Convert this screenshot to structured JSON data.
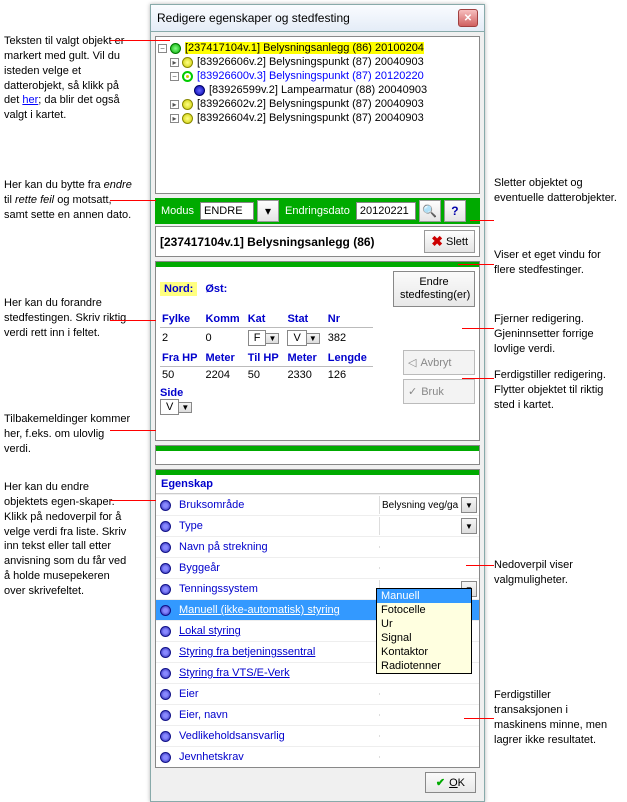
{
  "window_title": "Redigere egenskaper og stedfesting",
  "tree": [
    {
      "indent": 0,
      "toggle": "-",
      "icon": "green",
      "text": "[237417104v.1] Belysningsanlegg (86) 20100204",
      "hl": true
    },
    {
      "indent": 1,
      "toggle": ">",
      "icon": "yellow",
      "text": "[83926606v.2] Belysningspunkt (87) 20040903"
    },
    {
      "indent": 1,
      "toggle": "-",
      "icon": "ring",
      "text": "[83926600v.3] Belysningspunkt (87) 20120220",
      "sel": true
    },
    {
      "indent": 2,
      "toggle": "",
      "icon": "blue",
      "text": "[83926599v.2] Lampearmatur (88) 20040903"
    },
    {
      "indent": 1,
      "toggle": ">",
      "icon": "yellow",
      "text": "[83926602v.2] Belysningspunkt (87) 20040903"
    },
    {
      "indent": 1,
      "toggle": ">",
      "icon": "yellow",
      "text": "[83926604v.2] Belysningspunkt (87) 20040903"
    }
  ],
  "modus_label": "Modus",
  "modus_value": "ENDRE",
  "endringsdato_label": "Endringsdato",
  "endringsdato_value": "20120221",
  "help_icon": "?",
  "object_title": "[237417104v.1] Belysningsanlegg (86)",
  "slett_label": "Slett",
  "nord_label": "Nord:",
  "ost_label": "Øst:",
  "endre_sted_label": "Endre stedfesting(er)",
  "stedf_headers1": [
    "Fylke",
    "Komm",
    "Kat",
    "Stat",
    "Nr"
  ],
  "stedf_row1": [
    "2",
    "0",
    "F",
    "V",
    "382"
  ],
  "stedf_headers2": [
    "Fra HP",
    "Meter",
    "Til HP",
    "Meter",
    "Lengde"
  ],
  "stedf_row2": [
    "50",
    "2204",
    "50",
    "2330",
    "126"
  ],
  "side_label": "Side",
  "side_value": "V",
  "avbryt_label": "Avbryt",
  "bruk_label": "Bruk",
  "egenskap_header": "Egenskap",
  "properties": [
    {
      "name": "Bruksområde",
      "val": "Belysning veg/ga",
      "dd": true
    },
    {
      "name": "Type",
      "val": "",
      "dd": true
    },
    {
      "name": "Navn på strekning",
      "val": "",
      "dd": false
    },
    {
      "name": "Byggeår",
      "val": "",
      "dd": false
    },
    {
      "name": "Tenningssystem",
      "val": "",
      "dd": true,
      "open": true
    },
    {
      "name": "Manuell (ikke-automatisk) styring",
      "val": "",
      "sel": true,
      "ul": true
    },
    {
      "name": "Lokal styring",
      "val": "",
      "ul": true
    },
    {
      "name": "Styring fra betjeningssentral",
      "val": "",
      "ul": true
    },
    {
      "name": "Styring fra VTS/E-Verk",
      "val": "",
      "ul": true
    },
    {
      "name": "Eier",
      "val": "",
      "dd": false
    },
    {
      "name": "Eier, navn",
      "val": "",
      "dd": false
    },
    {
      "name": "Vedlikeholdsansvarlig",
      "val": "",
      "dd": false
    },
    {
      "name": "Jevnhetskrav",
      "val": "",
      "dd": false
    }
  ],
  "dropdown_options": [
    "Manuell",
    "Fotocelle",
    "Ur",
    "Signal",
    "Kontaktor",
    "Radiotenner"
  ],
  "ok_label": "OK",
  "annotations": {
    "a1": "Teksten til valgt objekt er markert med gult. Vil du isteden velge et datterobjekt, så klikk på det ",
    "a1_link": "her",
    "a1b": "; da blir det også valgt i kartet.",
    "a2": "Her kan du bytte fra ",
    "a2_i1": "endre",
    "a2_m": " til ",
    "a2_i2": "rette feil",
    "a2_e": " og motsatt, samt sette en annen dato.",
    "a3": "Her kan du forandre stedfestingen. Skriv riktig verdi rett inn i feltet.",
    "a4": "Tilbakemeldinger kommer her, f.eks. om ulovlig verdi.",
    "a5": "Her kan du endre objektets egen-skaper. Klikk på nedoverpil for å velge verdi fra liste. Skriv inn tekst eller tall etter anvisning som du får ved å holde musepekeren over skrivefeltet.",
    "b1": "Sletter objektet og eventuelle datterobjekter.",
    "b2": "Viser et eget vindu for flere stedfestinger.",
    "b3": "Fjerner redigering. Gjeninnsetter forrige lovlige verdi.",
    "b4": "Ferdigstiller redigering. Flytter objektet til riktig sted i kartet.",
    "b5": "Nedoverpil viser valgmuligheter.",
    "b6": "Ferdigstiller transaksjonen i maskinens minne, men lagrer ikke resultatet."
  }
}
